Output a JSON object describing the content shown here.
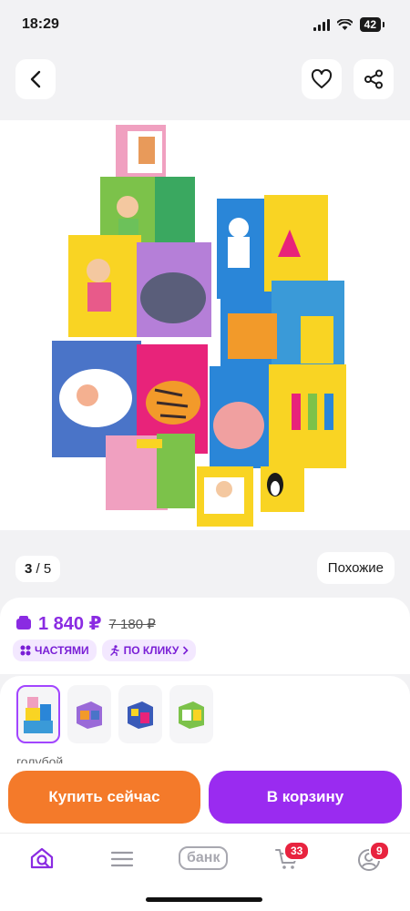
{
  "status": {
    "time": "18:29",
    "battery": "42",
    "icons": [
      "signal-icon",
      "wifi-icon",
      "battery-icon"
    ]
  },
  "header": {
    "back_icon": "chevron-left-icon",
    "favorite_icon": "heart-icon",
    "share_icon": "share-icon"
  },
  "gallery": {
    "image_description_icon": "product-photo-stacking-cubes",
    "counter_current": "3",
    "counter_total": "/ 5",
    "similar_label": "Похожие"
  },
  "price": {
    "current": "1 840 ₽",
    "old": "7 180 ₽",
    "chips": [
      {
        "label": "ЧАСТЯМИ",
        "icon": "parts-icon"
      },
      {
        "label": "ПО КЛИКУ",
        "icon": "running-person-icon"
      }
    ]
  },
  "variants": {
    "selected_label": "голубой",
    "thumbs": [
      "variant-blue",
      "variant-2",
      "variant-3",
      "variant-4"
    ]
  },
  "actions": {
    "buy_now": "Купить сейчас",
    "add_to_cart": "В корзину"
  },
  "tabbar": {
    "bank_label": "банк",
    "cart_badge": "33",
    "profile_badge": "9"
  },
  "colors": {
    "accent": "#8a2be2",
    "buy": "#f47a2a",
    "cart": "#9a2bf0",
    "badge": "#e8233f"
  }
}
